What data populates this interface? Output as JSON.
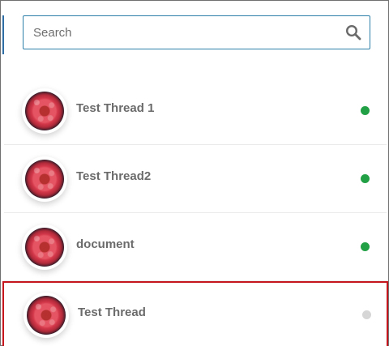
{
  "search": {
    "placeholder": "Search",
    "value": "",
    "icon": "search-icon"
  },
  "threads": [
    {
      "name": "Test Thread 1",
      "status": "online",
      "status_color": "#22a045",
      "selected": false,
      "avatar": "flower-avatar"
    },
    {
      "name": "Test Thread2",
      "status": "online",
      "status_color": "#22a045",
      "selected": false,
      "avatar": "flower-avatar"
    },
    {
      "name": "document",
      "status": "online",
      "status_color": "#22a045",
      "selected": false,
      "avatar": "flower-avatar"
    },
    {
      "name": "Test Thread",
      "status": "offline",
      "status_color": "#d6d6d6",
      "selected": true,
      "avatar": "flower-avatar"
    }
  ],
  "colors": {
    "accent": "#2b7fa8",
    "selection_border": "#c5161d",
    "text": "#6b6b6b"
  }
}
